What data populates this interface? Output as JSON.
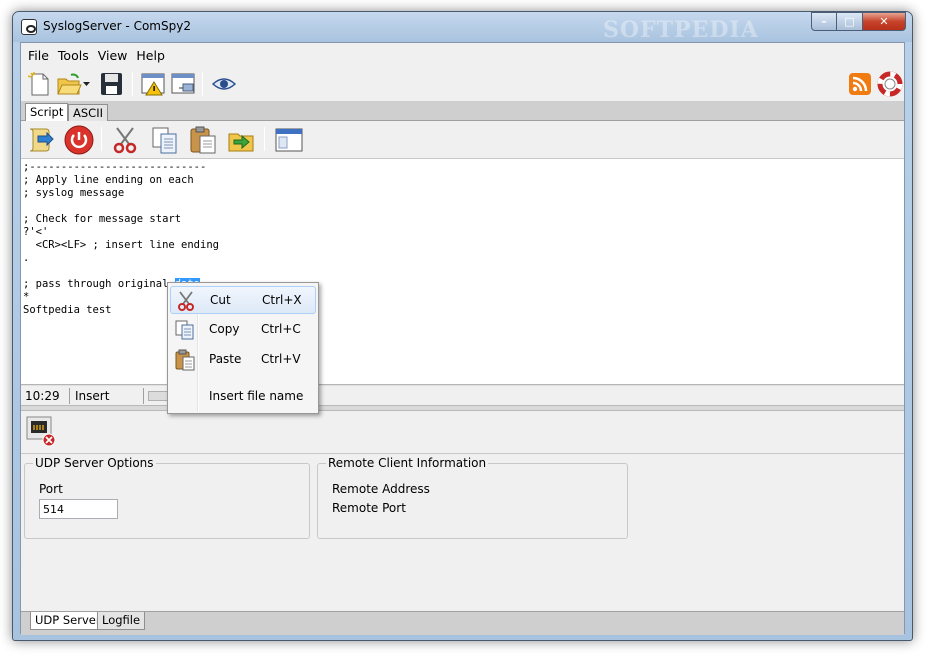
{
  "window": {
    "title": "SyslogServer - ComSpy2",
    "watermark": "SOFTPEDIA",
    "caption": {
      "minimize": "–",
      "maximize": "□",
      "close": "✕"
    }
  },
  "menu": [
    "File",
    "Tools",
    "View",
    "Help"
  ],
  "toolbar": {
    "icons": [
      "new-file-icon",
      "open-folder-icon",
      "open-dropdown-icon",
      "save-icon",
      "warning-window-icon",
      "network-window-icon",
      "eye-icon",
      "rss-icon",
      "help-lifebuoy-icon"
    ]
  },
  "top_tabs": [
    "Script",
    "ASCII"
  ],
  "script_toolbar": {
    "icons": [
      "script-run-icon",
      "power-icon",
      "cut-icon",
      "copy-icon",
      "paste-icon",
      "import-icon",
      "window-icon"
    ]
  },
  "editor": {
    "lines": [
      ";----------------------------",
      "; Apply line ending on each",
      "; syslog message",
      "",
      "; Check for message start",
      "?'<'",
      "  <CR><LF> ; insert line ending",
      ".",
      "",
      "; pass through original ",
      "*",
      "Softpedia test"
    ],
    "selected_word": "data"
  },
  "status": {
    "position": "10:29",
    "mode": "Insert"
  },
  "context_menu": {
    "items": [
      {
        "label": "Cut",
        "shortcut": "Ctrl+X",
        "icon": "scissors-icon"
      },
      {
        "label": "Copy",
        "shortcut": "Ctrl+C",
        "icon": "copy-icon"
      },
      {
        "label": "Paste",
        "shortcut": "Ctrl+V",
        "icon": "paste-icon"
      },
      {
        "label": "Insert file name",
        "shortcut": "",
        "icon": ""
      }
    ]
  },
  "udp_options": {
    "title": "UDP Server Options",
    "port_label": "Port",
    "port_value": "514"
  },
  "remote_client": {
    "title": "Remote Client Information",
    "address_label": "Remote Address",
    "port_label": "Remote Port"
  },
  "bottom_tabs": [
    "UDP Server",
    "Logfile"
  ]
}
